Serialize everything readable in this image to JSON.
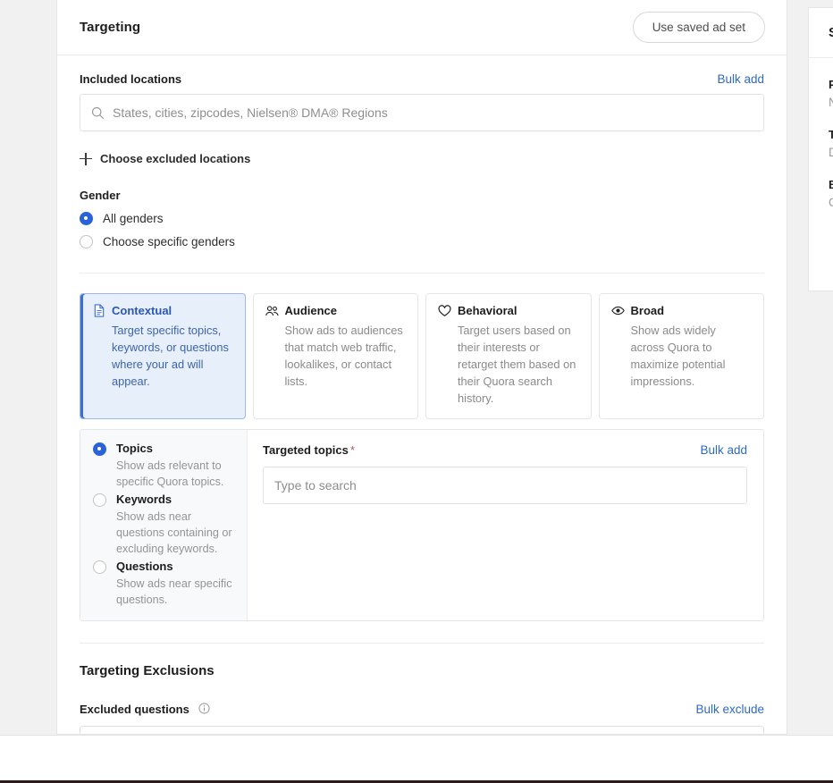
{
  "header": {
    "title": "Targeting",
    "saved_ad_set_button": "Use saved ad set"
  },
  "locations": {
    "label": "Included locations",
    "bulk_add": "Bulk add",
    "input_placeholder": "States, cities, zipcodes, Nielsen® DMA® Regions",
    "input_value": "",
    "excluded_link": "Choose excluded locations"
  },
  "gender": {
    "label": "Gender",
    "options": [
      {
        "label": "All genders",
        "selected": true
      },
      {
        "label": "Choose specific genders",
        "selected": false
      }
    ]
  },
  "targeting_types": [
    {
      "icon": "document-icon",
      "title": "Contextual",
      "description": "Target specific topics, keywords, or questions where your ad will appear.",
      "selected": true
    },
    {
      "icon": "people-group-icon",
      "title": "Audience",
      "description": "Show ads to audiences that match web traffic, lookalikes, or contact lists.",
      "selected": false
    },
    {
      "icon": "heart-icon",
      "title": "Behavioral",
      "description": "Target users based on their interests or retarget them based on their Quora search history.",
      "selected": false
    },
    {
      "icon": "eye-icon",
      "title": "Broad",
      "description": "Show ads widely across Quora to maximize potential impressions.",
      "selected": false
    }
  ],
  "contextual": {
    "options": [
      {
        "title": "Topics",
        "description": "Show ads relevant to specific Quora topics.",
        "selected": true
      },
      {
        "title": "Keywords",
        "description": "Show ads near questions containing or excluding keywords.",
        "selected": false
      },
      {
        "title": "Questions",
        "description": "Show ads near specific questions.",
        "selected": false
      }
    ],
    "panel": {
      "label": "Targeted topics",
      "required_mark": "*",
      "bulk_add": "Bulk add",
      "input_placeholder": "Type to search",
      "input_value": ""
    }
  },
  "exclusions": {
    "title": "Targeting Exclusions",
    "excluded_questions_label": "Excluded questions",
    "info_icon": "info-icon",
    "bulk_exclude": "Bulk exclude",
    "input_value": ""
  },
  "side_panel": {
    "title": "S",
    "groups": [
      {
        "label": "P",
        "value": "N"
      },
      {
        "label": "T",
        "value": "D"
      },
      {
        "label": "B",
        "value": "C"
      }
    ]
  },
  "colors": {
    "accent_blue": "#2962d9",
    "link_blue": "#2e69c4",
    "selected_card_bg": "#e7effb",
    "selected_card_text": "#2a57b8",
    "required_star": "#b45a5a"
  }
}
